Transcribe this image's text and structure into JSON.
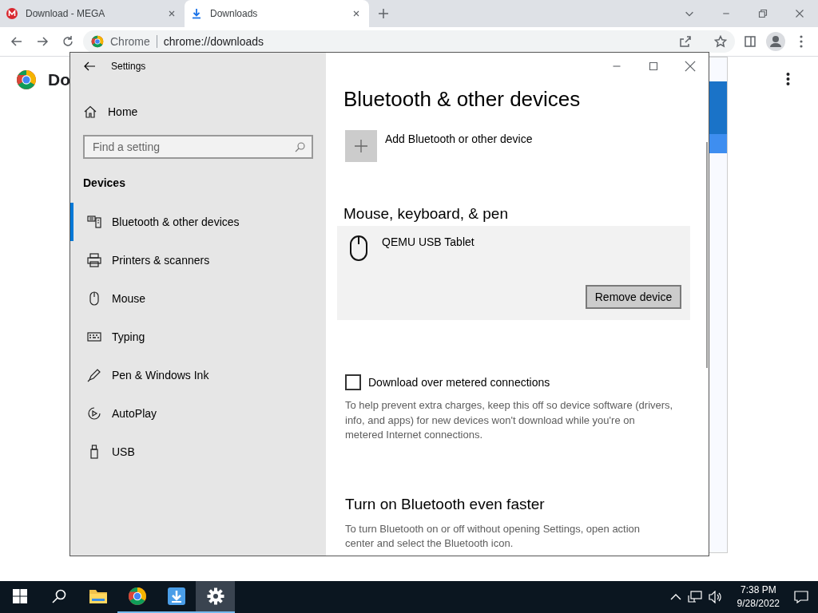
{
  "browser": {
    "tabs": [
      {
        "title": "Download - MEGA",
        "kind": "mega",
        "selected": false
      },
      {
        "title": "Downloads",
        "kind": "download",
        "selected": true
      }
    ],
    "address": {
      "site_label": "Chrome",
      "url": "chrome://downloads"
    },
    "page": {
      "title": "Do"
    }
  },
  "settings": {
    "title": "Settings",
    "home": "Home",
    "search": {
      "placeholder": "Find a setting"
    },
    "section": "Devices",
    "nav": [
      {
        "label": "Bluetooth & other devices",
        "kind": "bluetooth",
        "selected": true
      },
      {
        "label": "Printers & scanners",
        "kind": "printer",
        "selected": false
      },
      {
        "label": "Mouse",
        "kind": "mouse",
        "selected": false
      },
      {
        "label": "Typing",
        "kind": "keyboard",
        "selected": false
      },
      {
        "label": "Pen & Windows Ink",
        "kind": "pen",
        "selected": false
      },
      {
        "label": "AutoPlay",
        "kind": "autoplay",
        "selected": false
      },
      {
        "label": "USB",
        "kind": "usb",
        "selected": false
      }
    ],
    "heading": "Bluetooth & other devices",
    "add_device": "Add Bluetooth or other device",
    "group": "Mouse, keyboard, & pen",
    "device": {
      "name": "QEMU USB Tablet",
      "button": "Remove device"
    },
    "metered": {
      "label": "Download over metered connections",
      "checked": false
    },
    "metered_text": "To help prevent extra charges, keep this off so device software (drivers, info, and apps) for new devices won't download while you're on metered Internet connections.",
    "faster_heading": "Turn on Bluetooth even faster",
    "faster_text": "To turn Bluetooth on or off without opening Settings, open action center and select the Bluetooth icon."
  },
  "taskbar": {
    "apps": [
      {
        "kind": "explorer",
        "running": false,
        "selected": false
      },
      {
        "kind": "chrome",
        "running": true,
        "selected": false
      },
      {
        "kind": "downloader",
        "running": true,
        "selected": false
      },
      {
        "kind": "settings",
        "running": true,
        "selected": true
      }
    ],
    "time": "7:38 PM",
    "date": "9/28/2022"
  }
}
